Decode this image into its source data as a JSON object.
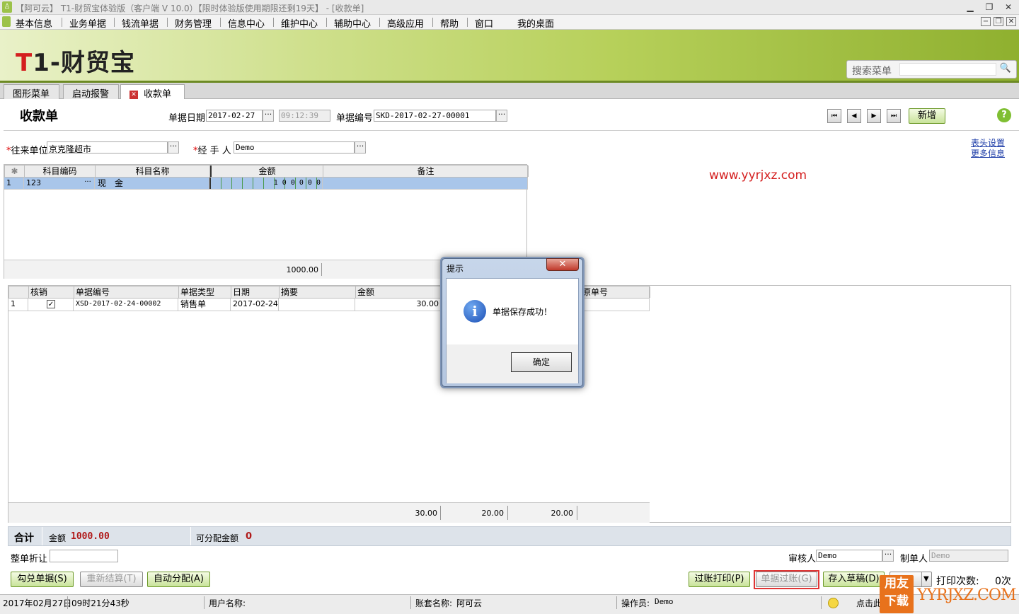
{
  "window": {
    "title": "【阿可云】 T1-财贸宝体验版（客户端 V 10.0）【限时体验版使用期限还剩19天】 - [收款单]",
    "min": "▁",
    "restore": "❐",
    "close": "✕",
    "child_min": "−",
    "child_restore": "❐",
    "child_close": "✕"
  },
  "menu": [
    "基本信息",
    "业务单据",
    "钱流单据",
    "财务管理",
    "信息中心",
    "维护中心",
    "辅助中心",
    "高级应用",
    "帮助",
    "窗口",
    "我的桌面"
  ],
  "banner": {
    "logo_t": "T",
    "logo_rest": "1-财贸宝",
    "search_label": "搜索菜单",
    "search_value": "",
    "search_icon": "🔍"
  },
  "tabs": [
    {
      "label": "图形菜单"
    },
    {
      "label": "启动报警"
    },
    {
      "label": "收款单",
      "close": "✕"
    }
  ],
  "form": {
    "title": "收款单",
    "date_label": "单据日期",
    "date_value": "2017-02-27",
    "time_value": "09:12:39",
    "number_label": "单据编号",
    "number_value": "SKD-2017-02-27-00001",
    "ellipsis": "···",
    "nav": [
      "⏮",
      "◀",
      "▶",
      "⏭"
    ],
    "new_button": "新增",
    "help_icon": "?",
    "partner_req": "*",
    "partner_label": "往来单位",
    "partner_value": "京克隆超市",
    "handler_req": "*",
    "handler_label": "经 手 人",
    "handler_value": "Demo",
    "header_settings": "表头设置",
    "more_info": "更多信息",
    "watermark": "www.yyrjxz.com"
  },
  "grid1": {
    "headers": [
      "✱",
      "科目编码",
      "科目名称",
      "金额",
      "备注"
    ],
    "rows": [
      {
        "idx": "1",
        "code": "123",
        "name": "现　金",
        "amount": "1 0 0 0 0 0",
        "note": ""
      }
    ],
    "total": "1000.00"
  },
  "grid2": {
    "headers": [
      "",
      "核销",
      "单据编号",
      "单据类型",
      "日期",
      "摘要",
      "金额",
      "",
      "原单号"
    ],
    "rows": [
      {
        "idx": "1",
        "checked": "✓",
        "number": "XSD-2017-02-24-00002",
        "type": "销售单",
        "date": "2017-02-24",
        "summary": "",
        "amount": "30.00"
      }
    ],
    "totals": [
      "30.00",
      "20.00",
      "20.00"
    ]
  },
  "summary": {
    "total_label": "合计",
    "amount_label": "金额",
    "amount_value": "1000.00",
    "alloc_label": "可分配金额",
    "alloc_value": "0",
    "discount_label": "整单折让",
    "discount_value": "",
    "auditor_label": "审核人",
    "auditor_value": "Demo",
    "maker_label": "制单人",
    "maker_value": "Demo"
  },
  "buttons": {
    "tick": "勾兑单据(S)",
    "recalc": "重新结算(T)",
    "auto": "自动分配(A)",
    "post_print": "过账打印(P)",
    "post": "单据过账(G)",
    "draft": "存入草稿(D)",
    "print_label": "打印次数:",
    "print_count": "0次"
  },
  "dialog": {
    "title": "提示",
    "close": "✕",
    "icon": "i",
    "message": "单据保存成功！",
    "ok": "确定"
  },
  "status": {
    "date": "2017年02月27日",
    "time": "09时21分43秒",
    "user_label": "用户名称:",
    "user_value": "",
    "set_label": "账套名称:",
    "set_value": "阿可云",
    "op_label": "操作员:",
    "op_value": "Demo",
    "hint": "点击此",
    "badge_top": "用友",
    "badge_bottom": "下载",
    "brand": "YYRJXZ.COM"
  },
  "colors": {
    "accent": "#d41f1f",
    "banner": "#b7d05a",
    "selected_row": "#a9c6ea"
  }
}
